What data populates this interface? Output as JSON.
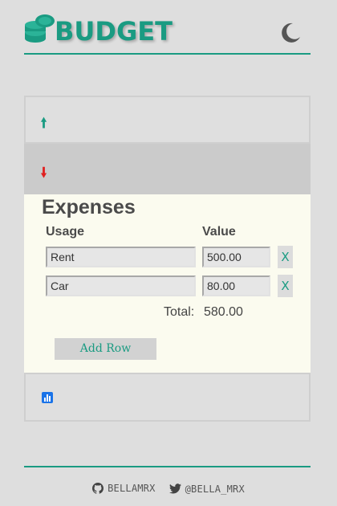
{
  "header": {
    "brand": "BUDGET",
    "logo_icon": "coins-stack-icon",
    "theme_icon": "moon-icon",
    "accent": "#1a9b82"
  },
  "accordion": {
    "income_icon": "arrow-up-icon",
    "expenses_icon": "arrow-down-icon",
    "chart_icon": "bar-chart-icon"
  },
  "expenses": {
    "title": "Expenses",
    "col_usage": "Usage",
    "col_value": "Value",
    "rows": [
      {
        "usage": "Rent",
        "value": "500.00",
        "remove": "X"
      },
      {
        "usage": "Car",
        "value": "80.00",
        "remove": "X"
      }
    ],
    "total_label": "Total:",
    "total_value": "580.00",
    "add_row_label": "Add Row"
  },
  "footer": {
    "github": "BELLAMRX",
    "twitter": "@BELLA_MRX"
  }
}
